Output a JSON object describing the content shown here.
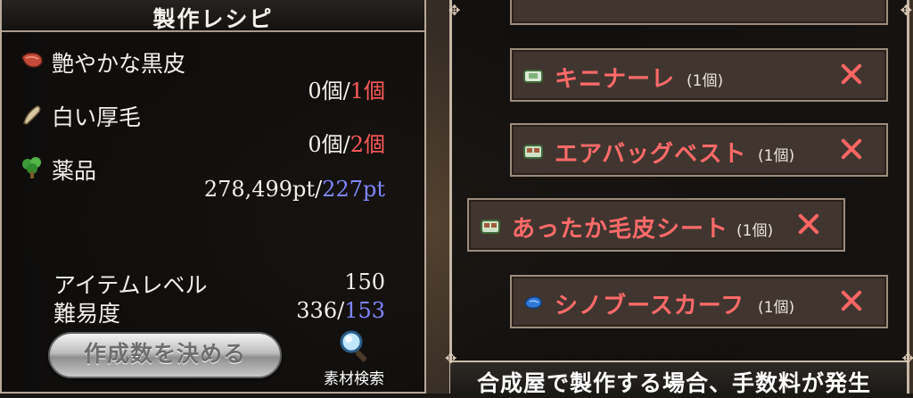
{
  "recipe_panel": {
    "title": "製作レシピ",
    "materials": [
      {
        "name": "艶やかな黒皮",
        "have": "0個",
        "sep": "/",
        "need": "1個",
        "icon": "red-leather-icon"
      },
      {
        "name": "白い厚毛",
        "have": "0個",
        "sep": "/",
        "need": "2個",
        "icon": "fur-icon"
      },
      {
        "name": "薬品",
        "have": "278,499pt",
        "sep": "/",
        "need": "227pt",
        "icon": "herb-icon"
      }
    ],
    "stats": {
      "item_level_label": "アイテムレベル",
      "item_level_value": "150",
      "difficulty_label": "難易度",
      "difficulty_have": "336",
      "difficulty_sep": "/",
      "difficulty_need": "153"
    },
    "craft_button": "作成数を決める",
    "search_label": "素材検索"
  },
  "queue": {
    "items": [
      {
        "name": "キニナーレ",
        "qty": "(1個)",
        "icon": "book-icon"
      },
      {
        "name": "エアバッグベスト",
        "qty": "(1個)",
        "icon": "box-icon"
      },
      {
        "name": "あったか毛皮シート",
        "qty": "(1個)",
        "icon": "box-icon"
      },
      {
        "name": "シノブースカーフ",
        "qty": "(1個)",
        "icon": "scarf-icon"
      }
    ],
    "bottom_notice": "合成屋で製作する場合、手数料が発生"
  },
  "colors": {
    "requirement_red": "#ff5a5a",
    "pt_blue": "#7f86ff",
    "item_name_red": "#ff6a6a"
  }
}
